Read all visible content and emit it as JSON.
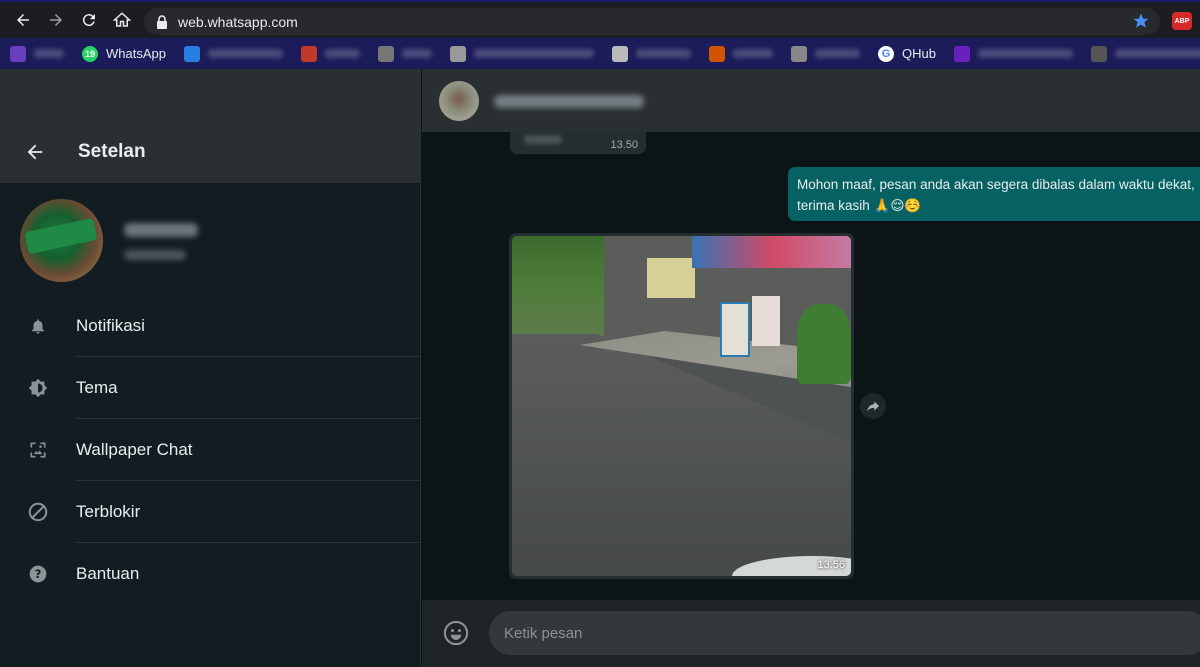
{
  "browser": {
    "url": "web.whatsapp.com",
    "adblock_badge": "ABP",
    "bookmarks": [
      {
        "label": "WhatsApp",
        "badge": "19",
        "color": "#25d366",
        "blurred": false
      },
      {
        "label": "QHub",
        "color": "#ffffff",
        "blurred": false
      }
    ]
  },
  "settings": {
    "title": "Setelan",
    "menu": [
      {
        "label": "Notifikasi",
        "icon": "bell-icon"
      },
      {
        "label": "Tema",
        "icon": "theme-icon"
      },
      {
        "label": "Wallpaper Chat",
        "icon": "wallpaper-icon"
      },
      {
        "label": "Terblokir",
        "icon": "blocked-icon"
      },
      {
        "label": "Bantuan",
        "icon": "help-icon"
      }
    ]
  },
  "chat": {
    "messages": [
      {
        "direction": "in",
        "time": "13.50"
      },
      {
        "direction": "out",
        "text": "Mohon maaf, pesan anda akan segera dibalas dalam waktu dekat, terima kasih 🙏😌☺️"
      },
      {
        "direction": "in",
        "type": "image",
        "time": "13.56"
      }
    ],
    "compose_placeholder": "Ketik pesan"
  },
  "colors": {
    "panel_header": "#2a2f32",
    "panel_bg": "#131c21",
    "outgoing_bubble": "#056162",
    "incoming_bubble": "#262d31"
  }
}
